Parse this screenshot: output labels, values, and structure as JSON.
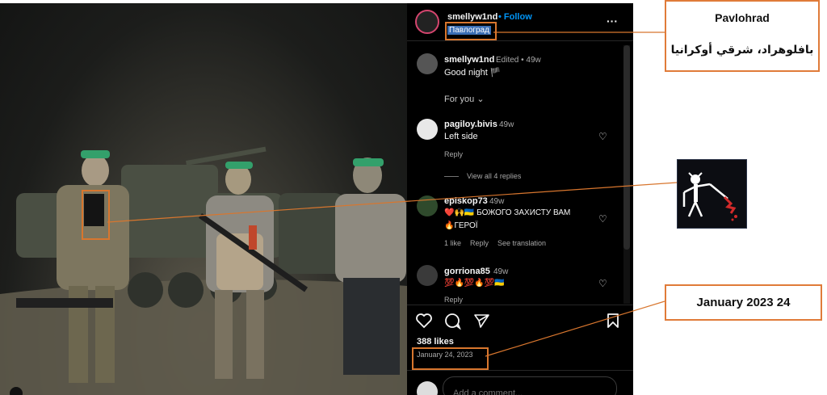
{
  "post": {
    "username": "smellyw1nd",
    "follow_label": "Follow",
    "location": "Павлоград",
    "more_label": "···",
    "caption": {
      "username": "smellyw1nd",
      "meta": "Edited • 49w",
      "text": "Good night 🏴"
    },
    "for_you_label": "For you ⌄",
    "comments": [
      {
        "username": "pagiloy.bivis",
        "time": "49w",
        "text": "Left side",
        "actions": "Reply"
      },
      {
        "username": "episkop73",
        "time": "49w",
        "text_line1": "❤️🙌🇺🇦 БОЖОГО ЗАХИСТУ ВАМ",
        "text_line2": "🔥ГЕРОЇ",
        "likes": "1 like",
        "reply": "Reply",
        "translation": "See translation"
      },
      {
        "username": "gorriona85",
        "time": "49w",
        "text": "💯🔥💯🔥💯🇺🇦",
        "actions": "Reply"
      }
    ],
    "view_replies_label": "View all 4 replies",
    "likes": "388 likes",
    "date": "January 24, 2023",
    "add_comment_placeholder": "Add a comment..."
  },
  "annotations": {
    "location_en": "Pavlohrad",
    "location_ar": "بافلوهراد، شرقي أوكرانيا",
    "date_callout": "January 2023 24"
  },
  "colors": {
    "callout_border": "#e07b39",
    "follow": "#0095f6",
    "location_highlight": "#3b6fb5"
  }
}
